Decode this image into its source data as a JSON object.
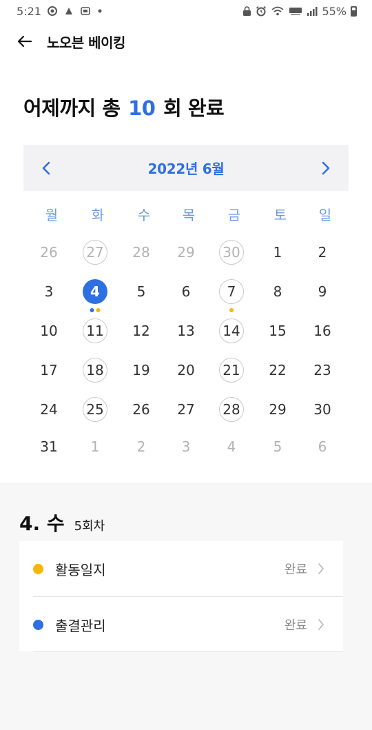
{
  "status_bar": {
    "time": "5:21",
    "battery": "55%",
    "left_icons": [
      "settings-icon",
      "app-notification-icon",
      "app-notification-icon",
      "dot-icon"
    ],
    "right_icons": [
      "lock-icon",
      "alarm-icon",
      "wifi-icon",
      "hd-voice-icon",
      "signal-icon",
      "battery-icon"
    ]
  },
  "appbar": {
    "back_icon": "back-arrow-icon",
    "title": "노오븐 베이킹"
  },
  "summary": {
    "prefix": "어제까지 총",
    "count": "10",
    "suffix": "회 완료"
  },
  "calendar": {
    "title": "2022년 6월",
    "prev_icon": "chevron-left-icon",
    "next_icon": "chevron-right-icon",
    "weekdays": [
      "월",
      "화",
      "수",
      "목",
      "금",
      "토",
      "일"
    ],
    "weeks": [
      [
        {
          "d": "26",
          "m": true
        },
        {
          "d": "27",
          "m": true,
          "ring": true
        },
        {
          "d": "28",
          "m": true
        },
        {
          "d": "29",
          "m": true
        },
        {
          "d": "30",
          "m": true,
          "ring": true
        },
        {
          "d": "1"
        },
        {
          "d": "2"
        }
      ],
      [
        {
          "d": "3"
        },
        {
          "d": "4",
          "selected": true,
          "dots": [
            "#2f6fe4",
            "#f5b800"
          ]
        },
        {
          "d": "5"
        },
        {
          "d": "6"
        },
        {
          "d": "7",
          "ring": true,
          "dots": [
            "#f5b800"
          ]
        },
        {
          "d": "8"
        },
        {
          "d": "9"
        }
      ],
      [
        {
          "d": "10"
        },
        {
          "d": "11",
          "ring": true
        },
        {
          "d": "12"
        },
        {
          "d": "13"
        },
        {
          "d": "14",
          "ring": true
        },
        {
          "d": "15"
        },
        {
          "d": "16"
        }
      ],
      [
        {
          "d": "17"
        },
        {
          "d": "18",
          "ring": true
        },
        {
          "d": "19"
        },
        {
          "d": "20"
        },
        {
          "d": "21",
          "ring": true
        },
        {
          "d": "22"
        },
        {
          "d": "23"
        }
      ],
      [
        {
          "d": "24"
        },
        {
          "d": "25",
          "ring": true
        },
        {
          "d": "26"
        },
        {
          "d": "27"
        },
        {
          "d": "28",
          "ring": true
        },
        {
          "d": "29"
        },
        {
          "d": "30"
        }
      ],
      [
        {
          "d": "31"
        },
        {
          "d": "1",
          "m": true
        },
        {
          "d": "2",
          "m": true
        },
        {
          "d": "3",
          "m": true
        },
        {
          "d": "4",
          "m": true
        },
        {
          "d": "5",
          "m": true
        },
        {
          "d": "6",
          "m": true
        }
      ]
    ]
  },
  "selected_day": {
    "date_label": "4. 수",
    "session": "5회차",
    "items": [
      {
        "label": "활동일지",
        "status": "완료",
        "color": "#f5b800"
      },
      {
        "label": "출결관리",
        "status": "완료",
        "color": "#2f6fe4"
      }
    ]
  },
  "colors": {
    "accent": "#2f6fe4",
    "activity_yellow": "#f5b800"
  }
}
